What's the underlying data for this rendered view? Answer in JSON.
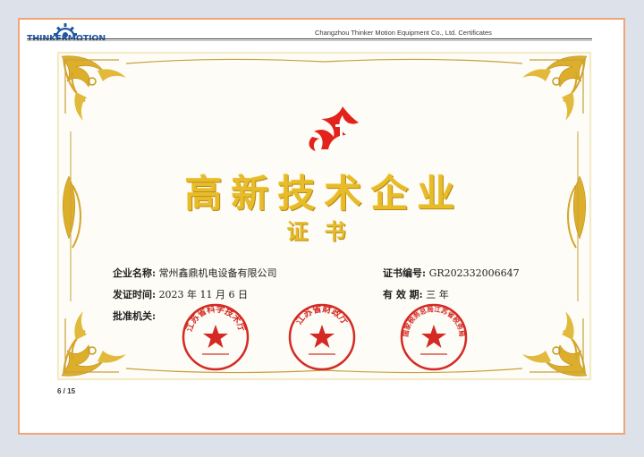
{
  "header": {
    "logo_text": "THINKERMOTION",
    "document_title": "Changzhou Thinker Motion Equipment Co., Ltd. Certificates"
  },
  "certificate": {
    "title": "高新技术企业",
    "subtitle": "证书",
    "company_label": "企业名称:",
    "company_value": "常州鑫鼎机电设备有限公司",
    "cert_no_label": "证书编号:",
    "cert_no_value": "GR202332006647",
    "issue_date_label": "发证时间:",
    "issue_date_value": "2023 年 11 月 6 日",
    "validity_label": "有 效 期:",
    "validity_value": "三 年",
    "authority_label": "批准机关:",
    "seals": [
      {
        "text": "江苏省科学技术厅"
      },
      {
        "text": "江苏省财政厅"
      },
      {
        "text": "国家税务总局江苏省税务局"
      }
    ]
  },
  "footer": {
    "page_indicator": "6 / 15"
  },
  "colors": {
    "page_border": "#f0a47a",
    "logo_blue": "#1f57a5",
    "title_gold": "#e7bb2a",
    "seal_red": "#d42a23",
    "emblem_red": "#e3231b"
  }
}
